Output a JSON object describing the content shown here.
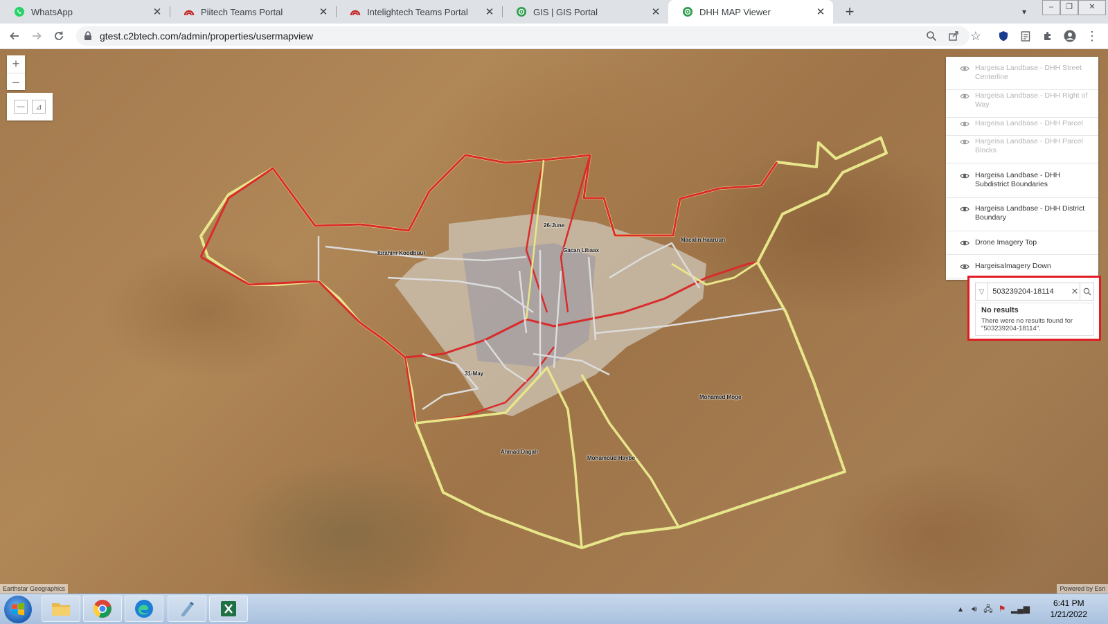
{
  "browser": {
    "tabs": [
      {
        "title": "WhatsApp",
        "icon": "whatsapp-icon",
        "active": false
      },
      {
        "title": "Piitech Teams Portal",
        "icon": "teams-portal-icon",
        "active": false
      },
      {
        "title": "Intelightech Teams Portal",
        "icon": "teams-portal-icon",
        "active": false
      },
      {
        "title": "GIS | GIS Portal",
        "icon": "gis-icon",
        "active": false
      },
      {
        "title": "DHH MAP Viewer",
        "icon": "gis-icon",
        "active": true
      }
    ],
    "new_tab": "+",
    "url": "gtest.c2btech.com/admin/properties/usermapview"
  },
  "map": {
    "districts": [
      "26-June",
      "Gacan Libaax",
      "Macalin Haaruun",
      "Ibrahim Koodbuur",
      "31-May",
      "Mohamed Moge",
      "Ahmad Dagah",
      "Mohamoud Haybe"
    ],
    "zoom_in": "+",
    "zoom_out": "–",
    "layers": [
      {
        "label": "Hargeisa Landbase - DHH Street Centerline",
        "visible": false
      },
      {
        "label": "Hargeisa Landbase - DHH Right of Way",
        "visible": false
      },
      {
        "label": "Hargeisa Landbase - DHH Parcel",
        "visible": false
      },
      {
        "label": "Hargeisa Landbase - DHH Parcel Blocks",
        "visible": false
      },
      {
        "label": "Hargeisa Landbase - DHH Subdistrict Boundaries",
        "visible": true
      },
      {
        "label": "Hargeisa Landbase - DHH District Boundary",
        "visible": true
      },
      {
        "label": "Drone Imagery Top",
        "visible": true
      },
      {
        "label": "HargeisaImagery Down",
        "visible": true
      }
    ],
    "search": {
      "value": "503239204-18114",
      "no_results_title": "No results",
      "no_results_message": "There were no results found for \"503239204-18114\"."
    },
    "attribution_left": "Earthstar Geographics",
    "attribution_right": "Powered by Esri"
  },
  "taskbar": {
    "time": "6:41 PM",
    "date": "1/21/2022"
  }
}
